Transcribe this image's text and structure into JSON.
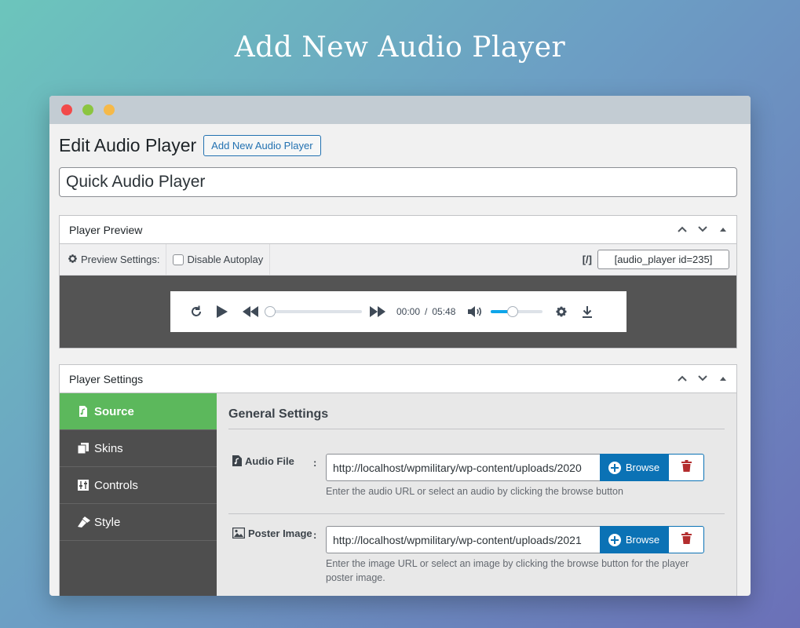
{
  "hero": {
    "title": "Add New Audio Player"
  },
  "header": {
    "title": "Edit Audio Player",
    "add_new_label": "Add New Audio Player"
  },
  "title_field": {
    "value": "Quick Audio Player"
  },
  "preview_panel": {
    "title": "Player Preview",
    "settings_label": "Preview Settings:",
    "autoplay_label": "Disable Autoplay",
    "autoplay_checked": false,
    "shortcode_icon": "[/]",
    "shortcode": "[audio_player id=235]"
  },
  "player": {
    "current_time": "00:00",
    "separator": "/",
    "duration": "05:48",
    "progress_fraction": 0,
    "volume_fraction": 0.42
  },
  "settings_panel": {
    "title": "Player Settings",
    "nav": [
      {
        "label": "Source",
        "icon": "music-file-icon",
        "active": true
      },
      {
        "label": "Skins",
        "icon": "copy-icon",
        "active": false
      },
      {
        "label": "Controls",
        "icon": "sliders-icon",
        "active": false
      },
      {
        "label": "Style",
        "icon": "brush-icon",
        "active": false
      }
    ],
    "section_title": "General Settings",
    "fields": {
      "audio": {
        "label": "Audio File",
        "colon": ":",
        "value": "http://localhost/wpmilitary/wp-content/uploads/2020",
        "browse_label": "Browse",
        "help": "Enter the audio URL or select an audio by clicking the browse button"
      },
      "poster": {
        "label": "Poster Image",
        "colon": ":",
        "value": "http://localhost/wpmilitary/wp-content/uploads/2021",
        "browse_label": "Browse",
        "help": "Enter the image URL or select an image by clicking the browse button for the player poster image."
      }
    }
  },
  "colors": {
    "accent": "#2271b1",
    "browse": "#0b72b5",
    "active_nav": "#5cb85c",
    "delete": "#b32d2e",
    "volume": "#0ea5e9"
  }
}
